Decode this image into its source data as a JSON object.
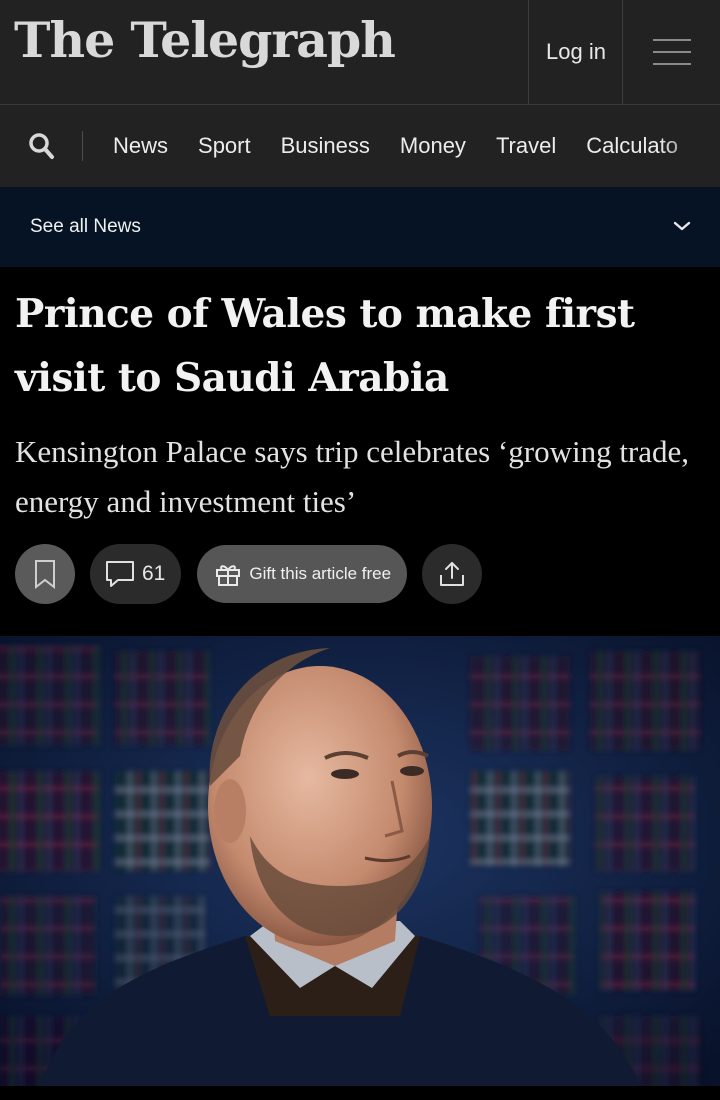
{
  "header": {
    "logo_text": "The Telegraph",
    "login_label": "Log in",
    "menu_icon": "hamburger-menu-icon"
  },
  "nav": {
    "search_icon": "search-icon",
    "items": [
      "News",
      "Sport",
      "Business",
      "Money",
      "Travel",
      "Calculato"
    ]
  },
  "section": {
    "see_all_label": "See all News",
    "chevron_icon": "chevron-down-icon"
  },
  "article": {
    "headline": "Prince of Wales to make first visit to Saudi Arabia",
    "standfirst": "Kensington Palace says trip celebrates ‘growing trade, energy and investment ties’",
    "comment_count": "61",
    "gift_label": "Gift this article free"
  },
  "colors": {
    "topbar_bg": "#222222",
    "section_bar_bg": "#061324",
    "page_bg": "#000000"
  }
}
